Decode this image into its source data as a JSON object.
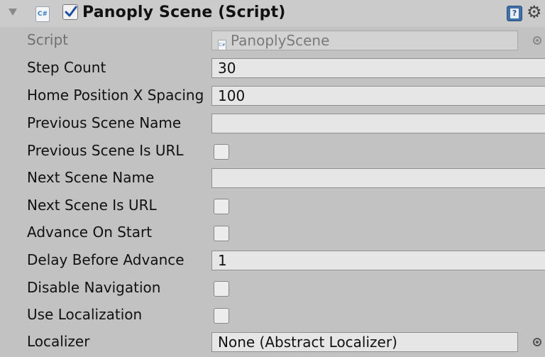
{
  "component": {
    "title": "Panoply Scene (Script)",
    "icon": "csharp-script-icon",
    "enabled": true
  },
  "fields": {
    "script": {
      "label": "Script",
      "value": "PanoplyScene"
    },
    "step_count": {
      "label": "Step Count",
      "value": "30"
    },
    "home_position_x_spacing": {
      "label": "Home Position X Spacing",
      "value": "100"
    },
    "previous_scene_name": {
      "label": "Previous Scene Name",
      "value": ""
    },
    "previous_scene_is_url": {
      "label": "Previous Scene Is URL",
      "checked": false
    },
    "next_scene_name": {
      "label": "Next Scene Name",
      "value": ""
    },
    "next_scene_is_url": {
      "label": "Next Scene Is URL",
      "checked": false
    },
    "advance_on_start": {
      "label": "Advance On Start",
      "checked": false
    },
    "delay_before_advance": {
      "label": "Delay Before Advance",
      "value": "1"
    },
    "disable_navigation": {
      "label": "Disable Navigation",
      "checked": false
    },
    "use_localization": {
      "label": "Use Localization",
      "checked": false
    },
    "localizer": {
      "label": "Localizer",
      "value": "None (Abstract Localizer)"
    }
  },
  "colors": {
    "panel_bg": "#c2c2c2",
    "field_bg": "#e6e6e6",
    "help_blue": "#3f6fa8"
  }
}
